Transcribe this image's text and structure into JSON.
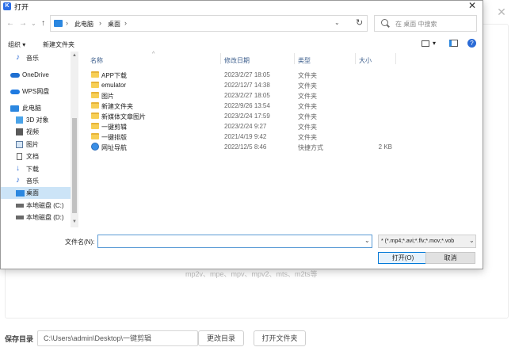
{
  "background": {
    "close_glyph": "✕",
    "formats_text": "mp2v、mpe、mpv、mpv2、mts、m2ts等",
    "save_label": "保存目录",
    "save_path": "C:\\Users\\admin\\Desktop\\一键剪辑",
    "change_dir_button": "更改目录",
    "open_folder_button": "打开文件夹"
  },
  "dialog": {
    "title": "打开",
    "title_icon_text": "K",
    "close_glyph": "✕",
    "nav": {
      "back": "←",
      "forward": "→",
      "dropdown": "⌄",
      "up": "↑"
    },
    "address": {
      "segments": [
        "此电脑",
        "桌面"
      ],
      "separator": "›",
      "refresh": "↻",
      "dropdown": "⌄"
    },
    "search": {
      "placeholder": "在 桌面 中搜索"
    },
    "toolbar": {
      "organize": "组织 ▾",
      "new_folder": "新建文件夹",
      "view_dropdown": "▾",
      "help": "?"
    },
    "sidebar": {
      "items": [
        {
          "label": "音乐",
          "icon": "music-note-icon",
          "color": "#2b6bd6"
        },
        {
          "label": "OneDrive",
          "icon": "cloud-icon",
          "color": "#1f6fd1"
        },
        {
          "label": "WPS网盘",
          "icon": "cloud-icon",
          "color": "#1f7ae0"
        },
        {
          "label": "此电脑",
          "icon": "computer-icon",
          "color": "#2b87e0"
        },
        {
          "label": "3D 对象",
          "icon": "cube-icon",
          "color": "#4aa3e8"
        },
        {
          "label": "视频",
          "icon": "film-icon",
          "color": "#5a5a5a"
        },
        {
          "label": "图片",
          "icon": "image-icon",
          "color": "#5a7aa0"
        },
        {
          "label": "文档",
          "icon": "document-icon",
          "color": "#6a6a6a"
        },
        {
          "label": "下载",
          "icon": "download-arrow-icon",
          "color": "#2b6bd6"
        },
        {
          "label": "音乐",
          "icon": "music-note-icon",
          "color": "#2b6bd6"
        },
        {
          "label": "桌面",
          "icon": "desktop-icon",
          "color": "#2b87e0"
        },
        {
          "label": "本地磁盘 (C:)",
          "icon": "drive-icon",
          "color": "#6a6a6a"
        },
        {
          "label": "本地磁盘 (D:)",
          "icon": "drive-icon",
          "color": "#6a6a6a"
        }
      ],
      "selected_index": 10
    },
    "columns": {
      "name": "名称",
      "date": "修改日期",
      "type": "类型",
      "size": "大小",
      "sort_arrow": "^"
    },
    "files": [
      {
        "name": "APP下载",
        "date": "2023/2/27 18:05",
        "type": "文件夹",
        "size": "",
        "icon": "folder-icon"
      },
      {
        "name": "emulator",
        "date": "2022/12/7 14:38",
        "type": "文件夹",
        "size": "",
        "icon": "folder-icon"
      },
      {
        "name": "图片",
        "date": "2023/2/27 18:05",
        "type": "文件夹",
        "size": "",
        "icon": "folder-icon"
      },
      {
        "name": "新建文件夹",
        "date": "2022/9/26 13:54",
        "type": "文件夹",
        "size": "",
        "icon": "folder-icon"
      },
      {
        "name": "新媒体文章图片",
        "date": "2023/2/24 17:59",
        "type": "文件夹",
        "size": "",
        "icon": "folder-icon"
      },
      {
        "name": "一键剪辑",
        "date": "2023/2/24 9:27",
        "type": "文件夹",
        "size": "",
        "icon": "folder-icon"
      },
      {
        "name": "一键排版",
        "date": "2021/4/19 9:42",
        "type": "文件夹",
        "size": "",
        "icon": "folder-icon"
      },
      {
        "name": "网址导航",
        "date": "2022/12/5 8:46",
        "type": "快捷方式",
        "size": "2 KB",
        "icon": "shortcut-icon"
      }
    ],
    "filename": {
      "label": "文件名(N):",
      "value": "",
      "dropdown": "⌄"
    },
    "filter": {
      "value": "* (*.mp4;*.avi;*.flv;*.mov;*.vob",
      "dropdown": "⌄"
    },
    "open_button": "打开(O)",
    "cancel_button": "取消"
  }
}
